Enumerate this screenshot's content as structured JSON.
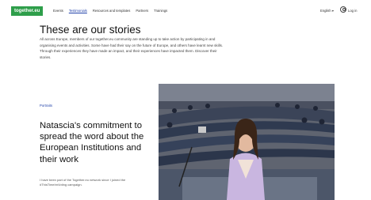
{
  "header": {
    "logo": "together.eu",
    "nav": [
      {
        "label": "Events",
        "active": false
      },
      {
        "label": "Testimonials",
        "active": true
      },
      {
        "label": "Resources and templates",
        "active": false
      },
      {
        "label": "Partners",
        "active": false
      },
      {
        "label": "Trainings",
        "active": false
      }
    ],
    "language": "English ▾",
    "login": "Log in"
  },
  "main": {
    "title": "These are our stories",
    "intro": "All across Europe, members of our together.eu community are standing up to take action by participating in and organising events and activities. Some have had their say on the future of Europe, and others have learnt new skills. Through their experiences they have made an impact, and their experiences have impacted them. Discover their stories."
  },
  "story": {
    "tag": "Portraits",
    "title": "Natascia's commitment to spread the word about the European Institutions and their work",
    "description": "I have been part of the Together.eu network since I joined the #ThisTimeImVoting campaign.",
    "image_alt": "Woman seated in the European Parliament hemicycle"
  }
}
